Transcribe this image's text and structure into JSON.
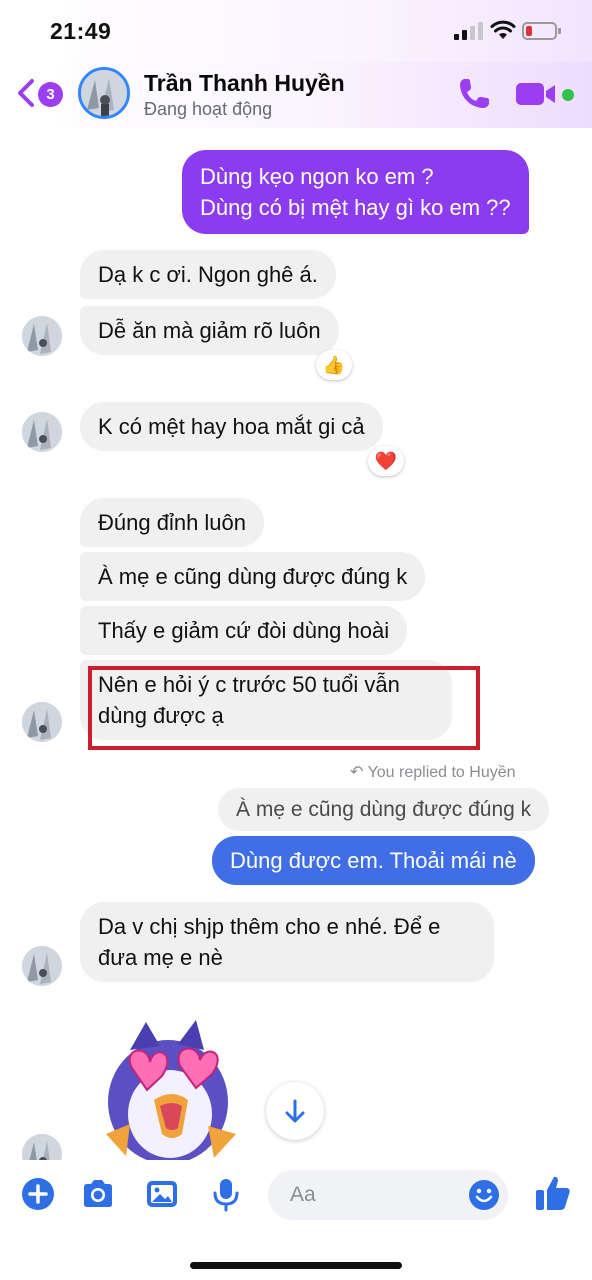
{
  "status_bar": {
    "time": "21:49"
  },
  "header": {
    "back_badge": "3",
    "contact_name": "Trần Thanh Huyền",
    "contact_status": "Đang hoạt động"
  },
  "messages": {
    "m1_line1": "Dùng kẹo ngon ko em ?",
    "m1_line2": "Dùng có bị mệt hay gì ko em ??",
    "m2": "Dạ k c ơi. Ngon ghê á.",
    "m3": "Dễ ăn mà giảm rõ luôn",
    "m3_reaction": "👍",
    "m4": "K có mệt hay hoa mắt gi cả",
    "m4_reaction": "❤️",
    "m5": "Đúng đỉnh luôn",
    "m6": "À mẹ e cũng dùng được đúng k",
    "m7": "Thấy e giảm cứ đòi dùng hoài",
    "m8_line1": "Nên e hỏi ý c trước 50 tuổi vẫn",
    "m8_line2": "dùng được ạ",
    "replied_note": "You replied to Huyền",
    "quoted": "À mẹ e cũng dùng được đúng k",
    "m9": "Dùng được em. Thoải mái nè",
    "m10_line1": "Da v chị shjp thêm cho e nhé. Để e",
    "m10_line2": "đưa mẹ e nè"
  },
  "composer": {
    "placeholder": "Aa"
  },
  "colors": {
    "accent_purple": "#8c3cf0",
    "accent_blue": "#3f6ee6",
    "highlight_red": "#c8202e",
    "incoming_bubble": "#f0f0f0",
    "online_green": "#31c24d"
  },
  "icons": {
    "back": "chevron-left-icon",
    "call": "phone-icon",
    "video": "video-camera-icon",
    "add": "plus-circle-icon",
    "camera": "camera-icon",
    "gallery": "image-icon",
    "mic": "microphone-icon",
    "emoji": "smiley-icon",
    "like": "thumbs-up-icon",
    "scroll": "arrow-down-icon"
  }
}
